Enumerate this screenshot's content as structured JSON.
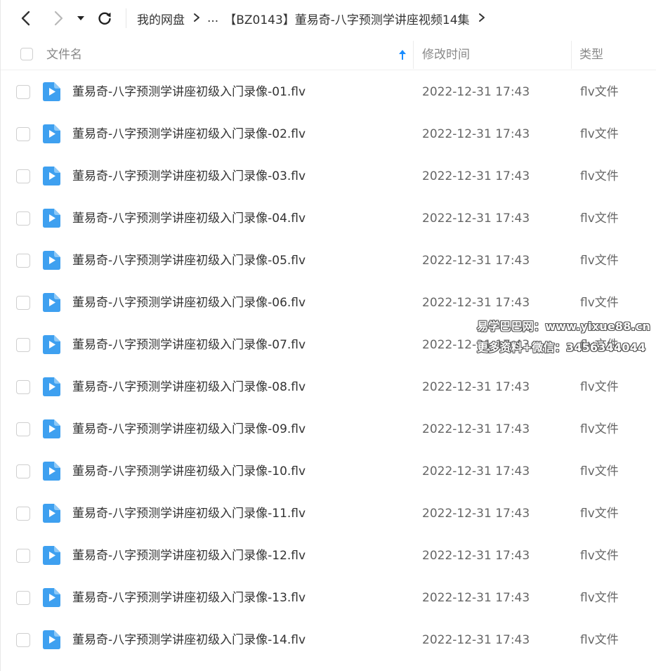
{
  "breadcrumb": {
    "root": "我的网盘",
    "ellipsis": "...",
    "current": "【BZ0143】董易奇-八字预测学讲座视频14集"
  },
  "table": {
    "columns": {
      "name": "文件名",
      "mtime": "修改时间",
      "type": "类型"
    },
    "rows": [
      {
        "name": "董易奇-八字预测学讲座初级入门录像-01.flv",
        "mtime": "2022-12-31 17:43",
        "type": "flv文件"
      },
      {
        "name": "董易奇-八字预测学讲座初级入门录像-02.flv",
        "mtime": "2022-12-31 17:43",
        "type": "flv文件"
      },
      {
        "name": "董易奇-八字预测学讲座初级入门录像-03.flv",
        "mtime": "2022-12-31 17:43",
        "type": "flv文件"
      },
      {
        "name": "董易奇-八字预测学讲座初级入门录像-04.flv",
        "mtime": "2022-12-31 17:43",
        "type": "flv文件"
      },
      {
        "name": "董易奇-八字预测学讲座初级入门录像-05.flv",
        "mtime": "2022-12-31 17:43",
        "type": "flv文件"
      },
      {
        "name": "董易奇-八字预测学讲座初级入门录像-06.flv",
        "mtime": "2022-12-31 17:43",
        "type": "flv文件"
      },
      {
        "name": "董易奇-八字预测学讲座初级入门录像-07.flv",
        "mtime": "2022-12-31 17:43",
        "type": "flv文件"
      },
      {
        "name": "董易奇-八字预测学讲座初级入门录像-08.flv",
        "mtime": "2022-12-31 17:43",
        "type": "flv文件"
      },
      {
        "name": "董易奇-八字预测学讲座初级入门录像-09.flv",
        "mtime": "2022-12-31 17:43",
        "type": "flv文件"
      },
      {
        "name": "董易奇-八字预测学讲座初级入门录像-10.flv",
        "mtime": "2022-12-31 17:43",
        "type": "flv文件"
      },
      {
        "name": "董易奇-八字预测学讲座初级入门录像-11.flv",
        "mtime": "2022-12-31 17:43",
        "type": "flv文件"
      },
      {
        "name": "董易奇-八字预测学讲座初级入门录像-12.flv",
        "mtime": "2022-12-31 17:43",
        "type": "flv文件"
      },
      {
        "name": "董易奇-八字预测学讲座初级入门录像-13.flv",
        "mtime": "2022-12-31 17:43",
        "type": "flv文件"
      },
      {
        "name": "董易奇-八字预测学讲座初级入门录像-14.flv",
        "mtime": "2022-12-31 17:43",
        "type": "flv文件"
      }
    ]
  },
  "watermark": {
    "line1": "易学巴巴网：www.yixue88.cn",
    "line2": "更多资料+微信：3456344044"
  },
  "icons": {
    "back": "chevron-left-icon",
    "forward": "chevron-right-icon",
    "history": "caret-down-icon",
    "refresh": "refresh-icon",
    "sort": "arrow-up-icon",
    "file": "video-file-icon"
  },
  "colors": {
    "accent": "#1a8cff",
    "video_icon": "#3ea0f0",
    "disabled_nav": "#b8b8b8"
  }
}
